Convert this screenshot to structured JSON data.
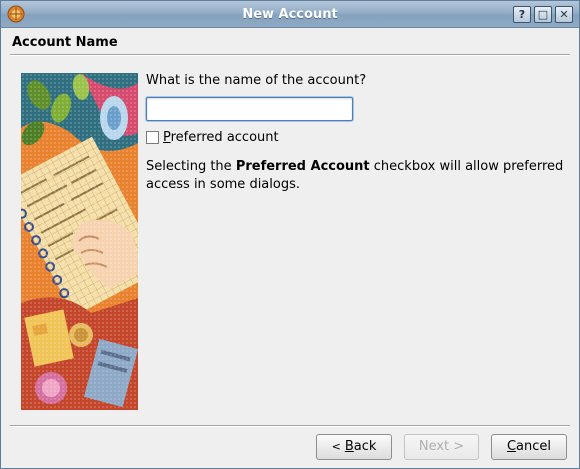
{
  "window": {
    "title": "New Account",
    "help_label": "?",
    "maximize_label": "□",
    "close_label": "✕"
  },
  "page": {
    "section_title": "Account Name",
    "question": "What is the name of the account?",
    "name_value": "",
    "preferred_label_prefix": "P",
    "preferred_label_rest": "referred account",
    "info_before": "Selecting the ",
    "info_bold": "Preferred Account",
    "info_after": " checkbox will allow preferred access in some dialogs."
  },
  "buttons": {
    "back_glyph": "<",
    "back_prefix": "B",
    "back_rest": "ack",
    "next_label": "Next >",
    "cancel_prefix": "C",
    "cancel_rest": "ancel"
  },
  "colors": {
    "titlebar": "#93adc7",
    "focus_border": "#4c7fb3",
    "disabled_text": "#aeaeae"
  }
}
